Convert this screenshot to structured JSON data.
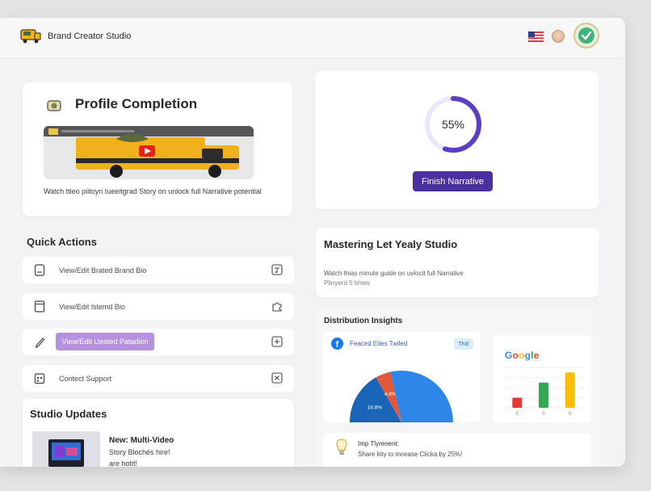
{
  "header": {
    "brand_name": "Brand Creator Studio",
    "flag_icon": "us-flag-icon",
    "verified_icon": "verified-badge-icon"
  },
  "profile": {
    "title": "Profile Completion",
    "caption": "Watch ttieo piitoyn tueeitgrad Story on unlock full Narrative potential"
  },
  "progress": {
    "percent_label": "55%",
    "percent_value": 55,
    "button_label": "Finish Narrative",
    "accent": "#5a3fc4"
  },
  "quick_actions": {
    "heading": "Quick Actions",
    "items": [
      {
        "label": "View/Edit Brated Brand Bio",
        "lead_icon": "document-icon",
        "trail_icon": "edit-square-icon"
      },
      {
        "label": "View/Edit lstemd Bio",
        "lead_icon": "page-icon",
        "trail_icon": "puzzle-icon"
      },
      {
        "label": "View/Edit Ueated Patadion",
        "lead_icon": "pencil-icon",
        "trail_icon": "add-square-icon",
        "highlight": "#b591e0"
      },
      {
        "label": "Contect Support",
        "lead_icon": "calendar-icon",
        "trail_icon": "close-square-icon"
      }
    ]
  },
  "updates": {
    "title": "Studio Updates",
    "head": "New: Multi-Video",
    "line1": "Story Blochés hire!",
    "line2": "are hotit!"
  },
  "mastering": {
    "title": "Mastering Let Yealy Studio",
    "subtitle": "Watch thias minute guide on uvlocit full Narrative",
    "plays": "Plinyerd 5 times"
  },
  "insights": {
    "title": "Distribution Insights",
    "facebook": {
      "label": "Feaced Eties Twiled",
      "tag": "Thitl",
      "chart_data": {
        "type": "pie",
        "slices": [
          {
            "label": "16.8%",
            "value": 16.8,
            "color": "#1a64b8"
          },
          {
            "label": "4.8%",
            "value": 4.8,
            "color": "#e2583a"
          },
          {
            "label": "",
            "value": 28.4,
            "color": "#2e86e8"
          }
        ]
      }
    },
    "google": {
      "logo": "Google",
      "chart_data": {
        "type": "bar",
        "categories": [
          "0",
          "0",
          "0"
        ],
        "values": [
          2,
          5,
          7
        ],
        "colors": [
          "#e53935",
          "#34a853",
          "#fbbc05"
        ],
        "ylim": [
          0,
          8
        ]
      }
    },
    "tip": {
      "title": "Imp Tlyrenent:",
      "text": "Share kity to incease Clicka by 25%!"
    }
  }
}
